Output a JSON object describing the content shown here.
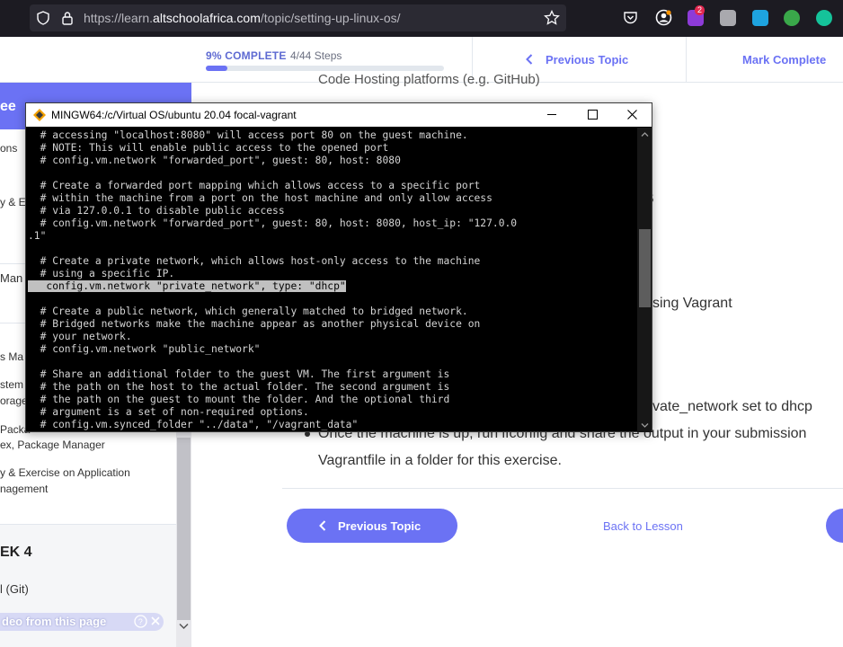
{
  "browser": {
    "url_prefix": "https://learn.",
    "url_domain": "altschoolafrica.com",
    "url_path": "/topic/setting-up-linux-os/",
    "extension_badge": "2"
  },
  "header": {
    "progress_label": "9% COMPLETE",
    "progress_steps": "4/44 Steps",
    "progress_fraction": 0.09,
    "previous_topic": "Previous Topic",
    "mark_complete": "Mark Complete"
  },
  "sidebar": {
    "head_text": "ee",
    "items": [
      "ons",
      "y & Ex",
      "Man",
      "s Ma",
      "stem",
      "orage",
      "Packa",
      "ex, Package Manager",
      "y & Exercise on Application",
      "nagement"
    ],
    "week": "EK 4",
    "git": "l (Git)",
    "video_text": "deo from this page"
  },
  "main": {
    "frag_top": "Code Hosting platforms (e.g. GitHub)",
    "frag_s": "s",
    "frag_vagrant": "sing Vagrant",
    "frag_dhcp": "vate_network set to dhcp",
    "bullet_text": "Once the machine is up, run ifconfig and share the output in your submission",
    "line2": "Vagrantfile in a folder for this exercise.",
    "prev_button": "Previous Topic",
    "back_to_lesson": "Back to Lesson"
  },
  "terminal": {
    "title": "MINGW64:/c/Virtual OS/ubuntu 20.04 focal-vagrant",
    "lines": [
      "  # accessing \"localhost:8080\" will access port 80 on the guest machine.",
      "  # NOTE: This will enable public access to the opened port",
      "  # config.vm.network \"forwarded_port\", guest: 80, host: 8080",
      "",
      "  # Create a forwarded port mapping which allows access to a specific port",
      "  # within the machine from a port on the host machine and only allow access",
      "  # via 127.0.0.1 to disable public access",
      "  # config.vm.network \"forwarded_port\", guest: 80, host: 8080, host_ip: \"127.0.0",
      ".1\"",
      "",
      "  # Create a private network, which allows host-only access to the machine",
      "  # using a specific IP.",
      "   config.vm.network \"private_network\", type: \"dhcp\"",
      "",
      "  # Create a public network, which generally matched to bridged network.",
      "  # Bridged networks make the machine appear as another physical device on",
      "  # your network.",
      "  # config.vm.network \"public_network\"",
      "",
      "  # Share an additional folder to the guest VM. The first argument is",
      "  # the path on the host to the actual folder. The second argument is",
      "  # the path on the guest to mount the folder. And the optional third",
      "  # argument is a set of non-required options.",
      "  # config.vm.synced_folder \"../data\", \"/vagrant_data\""
    ]
  }
}
